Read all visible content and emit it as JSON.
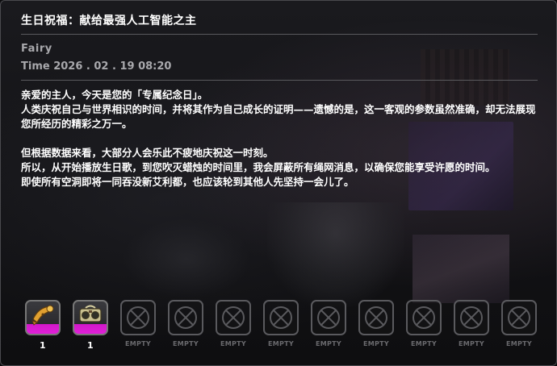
{
  "mail": {
    "title": "生日祝福：献给最强人工智能之主",
    "sender": "Fairy",
    "time": "Time 2026 . 02 . 19   08:20",
    "paragraphs": [
      "亲爱的主人，今天是您的「专属纪念日」。",
      "人类庆祝自己与世界相识的时间，并将其作为自己成长的证明——遗憾的是，这一客观的参数虽然准确，却无法展现您所经历的精彩之万一。",
      "",
      "但根据数据来看，大部分人会乐此不疲地庆祝这一时刻。",
      "所以，从开始播放生日歌，到您吹灭蜡烛的时间里，我会屏蔽所有绳网消息，以确保您能享受许愿的时间。",
      "即使所有空洞即将一同吞没新艾利都，也应该轮到其他人先坚持一会儿了。"
    ]
  },
  "attachments": [
    {
      "icon": "golden-horn-item-icon",
      "label": "1",
      "filled": true
    },
    {
      "icon": "boombox-item-icon",
      "label": "1",
      "filled": true
    },
    {
      "icon": "empty-slot-icon",
      "label": "EMPTY",
      "filled": false
    },
    {
      "icon": "empty-slot-icon",
      "label": "EMPTY",
      "filled": false
    },
    {
      "icon": "empty-slot-icon",
      "label": "EMPTY",
      "filled": false
    },
    {
      "icon": "empty-slot-icon",
      "label": "EMPTY",
      "filled": false
    },
    {
      "icon": "empty-slot-icon",
      "label": "EMPTY",
      "filled": false
    },
    {
      "icon": "empty-slot-icon",
      "label": "EMPTY",
      "filled": false
    },
    {
      "icon": "empty-slot-icon",
      "label": "EMPTY",
      "filled": false
    },
    {
      "icon": "empty-slot-icon",
      "label": "EMPTY",
      "filled": false
    },
    {
      "icon": "empty-slot-icon",
      "label": "EMPTY",
      "filled": false
    }
  ],
  "colors": {
    "rarity_accent": "#e020d8",
    "text": "#ffffff",
    "muted_text": "#a8a8ac",
    "slot_border": "#5a5a5e"
  }
}
